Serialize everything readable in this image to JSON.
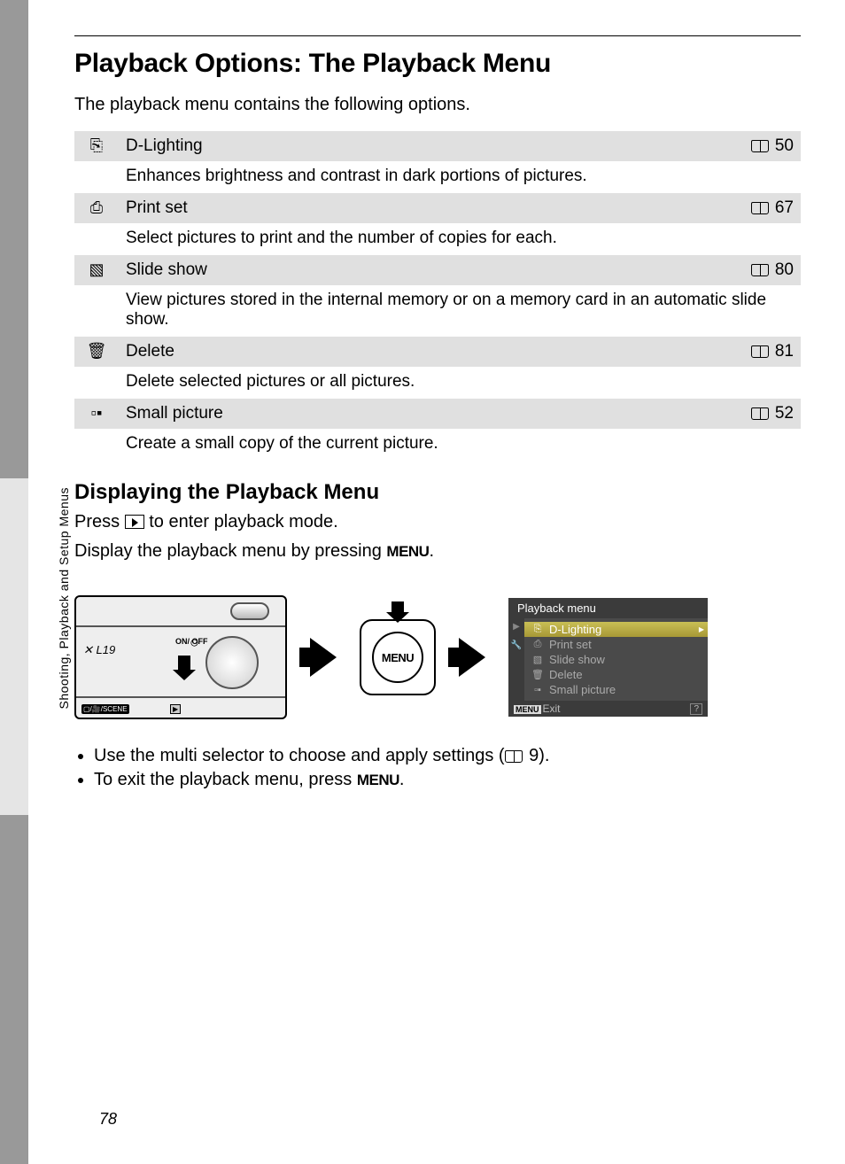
{
  "header": {
    "title": "Playback Options: The Playback Menu"
  },
  "intro": "The playback menu contains the following options.",
  "options": [
    {
      "icon": "⎘",
      "name": "D-Lighting",
      "page": "50",
      "desc": "Enhances brightness and contrast in dark portions of pictures."
    },
    {
      "icon": "⎙",
      "name": "Print set",
      "page": "67",
      "desc": "Select pictures to print and the number of copies for each."
    },
    {
      "icon": "▧",
      "name": "Slide show",
      "page": "80",
      "desc": "View pictures stored in the internal memory or on a memory card in an automatic slide show."
    },
    {
      "icon": "🗑",
      "name": "Delete",
      "page": "81",
      "desc": "Delete selected pictures or all pictures."
    },
    {
      "icon": "▫▪",
      "name": "Small picture",
      "page": "52",
      "desc": "Create a small copy of the current picture."
    }
  ],
  "subheading": "Displaying the Playback Menu",
  "para1_a": "Press ",
  "para1_b": " to enter playback mode.",
  "para2_a": "Display the playback menu by pressing ",
  "para2_b": ".",
  "menu_label": "MENU",
  "camera": {
    "model": "L19",
    "power": "ON/\nOFF",
    "mode": "▢/🎥/SCENE",
    "play": "▶"
  },
  "screen": {
    "title": "Playback menu",
    "items": [
      {
        "icon": "⎘",
        "label": "D-Lighting",
        "selected": true
      },
      {
        "icon": "⎙",
        "label": "Print set"
      },
      {
        "icon": "▧",
        "label": "Slide show"
      },
      {
        "icon": "🗑",
        "label": "Delete"
      },
      {
        "icon": "▫▪",
        "label": "Small picture"
      }
    ],
    "exit_tag": "MENU",
    "exit": "Exit",
    "help": "?"
  },
  "bullets": {
    "b1_a": "Use the multi selector to choose and apply settings (",
    "b1_page": "9",
    "b1_b": ").",
    "b2_a": "To exit the playback menu, press ",
    "b2_b": "."
  },
  "side_label": "Shooting, Playback and Setup Menus",
  "page_number": "78"
}
